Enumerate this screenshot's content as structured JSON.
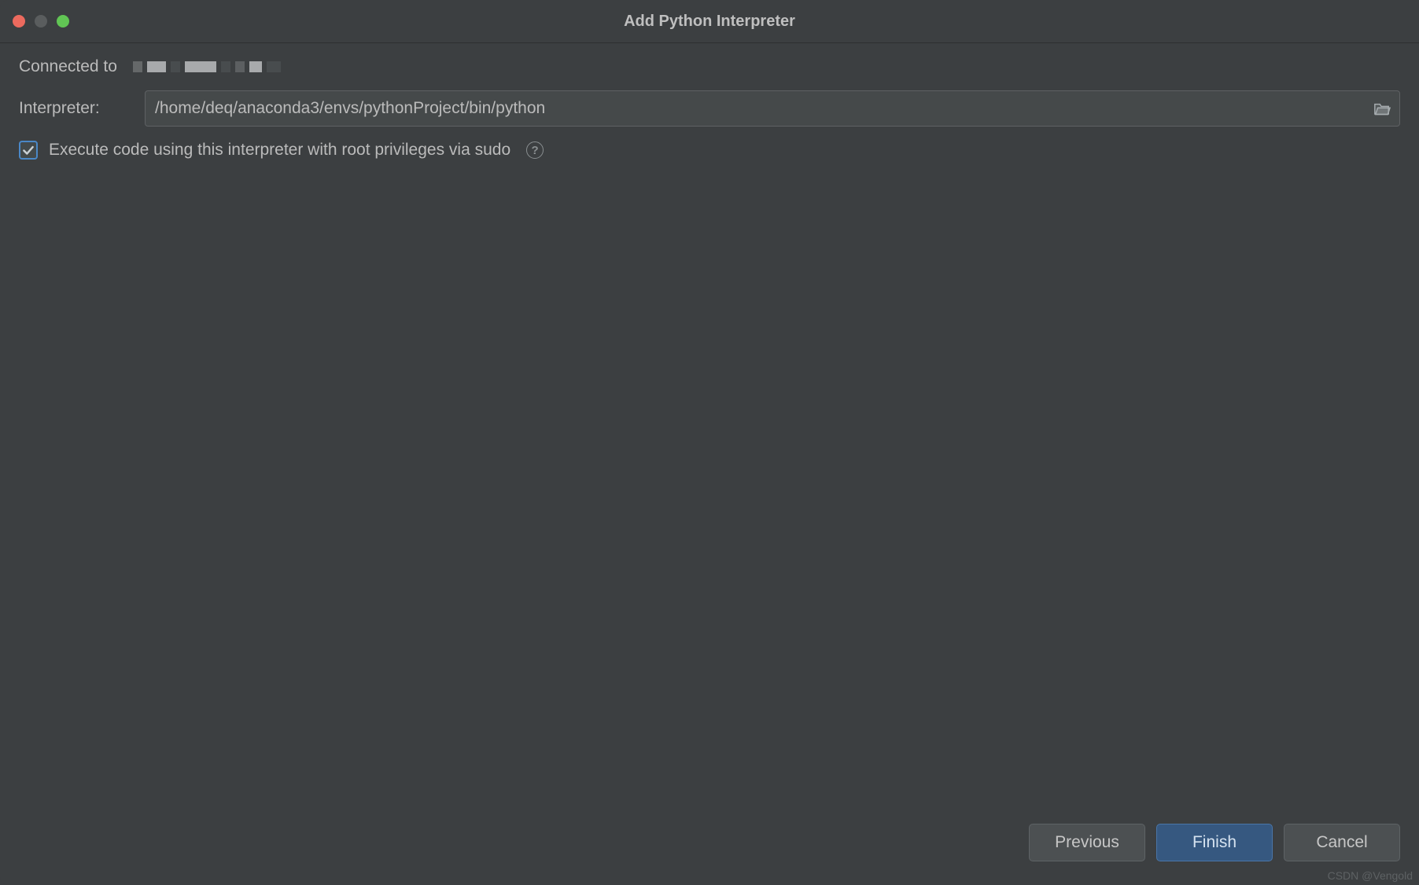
{
  "title": "Add Python Interpreter",
  "connected_label": "Connected to",
  "interpreter_label": "Interpreter:",
  "interpreter_path": "/home/deq/anaconda3/envs/pythonProject/bin/python",
  "sudo_checkbox_label": "Execute code using this interpreter with root privileges via sudo",
  "buttons": {
    "previous": "Previous",
    "finish": "Finish",
    "cancel": "Cancel"
  },
  "watermark": "CSDN @Vengold",
  "colors": {
    "window_bg": "#3c3f41",
    "input_bg": "#45494a",
    "border": "#5e6163",
    "text": "#bbbbbb",
    "primary": "#365880",
    "checkbox_border": "#4a88c7"
  }
}
